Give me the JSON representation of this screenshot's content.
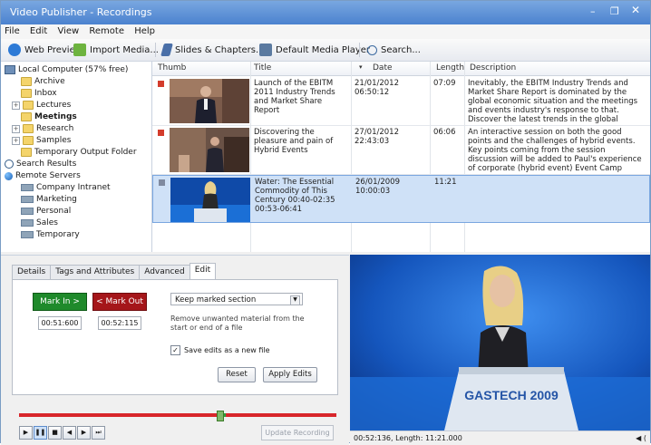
{
  "window": {
    "title": "Video Publisher - Recordings",
    "controls": {
      "minimize": "–",
      "maximize": "❐",
      "close": "✕"
    }
  },
  "menu": [
    "File",
    "Edit",
    "View",
    "Remote",
    "Help"
  ],
  "toolbar": [
    {
      "label": "Web Preview",
      "icon": "web-preview-icon",
      "color": "#2d7ad6"
    },
    {
      "label": "Import Media...",
      "icon": "import-icon",
      "color": "#6db33f"
    },
    {
      "label": "Slides & Chapters...",
      "icon": "slides-icon",
      "color": "#4a6fa8"
    },
    {
      "label": "Default Media Player",
      "icon": "media-player-icon",
      "color": "#5b7aa0"
    },
    {
      "label": "Search...",
      "icon": "search-icon",
      "color": "#3c6aa0"
    }
  ],
  "tree": {
    "root": "Local Computer (57% free)",
    "folders": [
      "Archive",
      "Inbox",
      "Lectures",
      "Meetings",
      "Research",
      "Samples",
      "Temporary Output Folder"
    ],
    "search": "Search Results",
    "remote": "Remote Servers",
    "servers": [
      "Company Intranet",
      "Marketing",
      "Personal",
      "Sales",
      "Temporary"
    ]
  },
  "grid": {
    "columns": [
      "Thumb",
      "Title",
      "Date",
      "Length",
      "Description"
    ],
    "rows": [
      {
        "title": "Launch of the EBITM 2011 Industry Trends and Market Share Report",
        "date": "21/01/2012 06:50:12",
        "length": "07:09",
        "description": "Inevitably, the EBITM Industry Trends and Market Share Report is dominated by the global economic situation and the meetings and events industry's response to that. Discover the latest trends in the global market for corporate meetings. au. Folikim"
      },
      {
        "title": "Discovering the pleasure and pain of Hybrid Events",
        "date": "27/01/2012 22:43:03",
        "length": "06:06",
        "description": "An interactive session on both the good points and the challenges of hybrid events. Key points coming from the session discussion will be added to Paul's experience of corporate (hybrid event) Event Camp Europe. Together this will form th... Pebbles"
      },
      {
        "title": "Water: The Essential Commodity of This Century 00:40-02:35 00:53-06:41",
        "date": "26/01/2009 10:00:03",
        "length": "11:21",
        "description": ""
      }
    ]
  },
  "tabs": [
    "Details",
    "Tags and Attributes",
    "Advanced",
    "Edit"
  ],
  "edit": {
    "mark_in": "Mark In >",
    "mark_out": "< Mark Out",
    "in_time": "00:51:600",
    "out_time": "00:52:115",
    "mode": "Keep marked section",
    "mode_description": "Remove unwanted material from the start or end of a file",
    "save_as_new_label": "Save edits as a new file",
    "save_as_new_checked": true,
    "reset": "Reset",
    "apply": "Apply Edits",
    "update": "Update Recording"
  },
  "timeline": {
    "position_fraction": 0.63
  },
  "transport": [
    "play",
    "pause",
    "stop",
    "rewind",
    "forward",
    "end"
  ],
  "video": {
    "podium_text": "GASTECH 2009"
  },
  "status": {
    "left": "00:52:136, Length: 11:21.000",
    "right": "◀ ("
  },
  "colors": {
    "accent": "#3c7fd9",
    "mark_in": "#1f8a2b",
    "mark_out": "#a5161a",
    "selection": "#cfe1f7"
  }
}
